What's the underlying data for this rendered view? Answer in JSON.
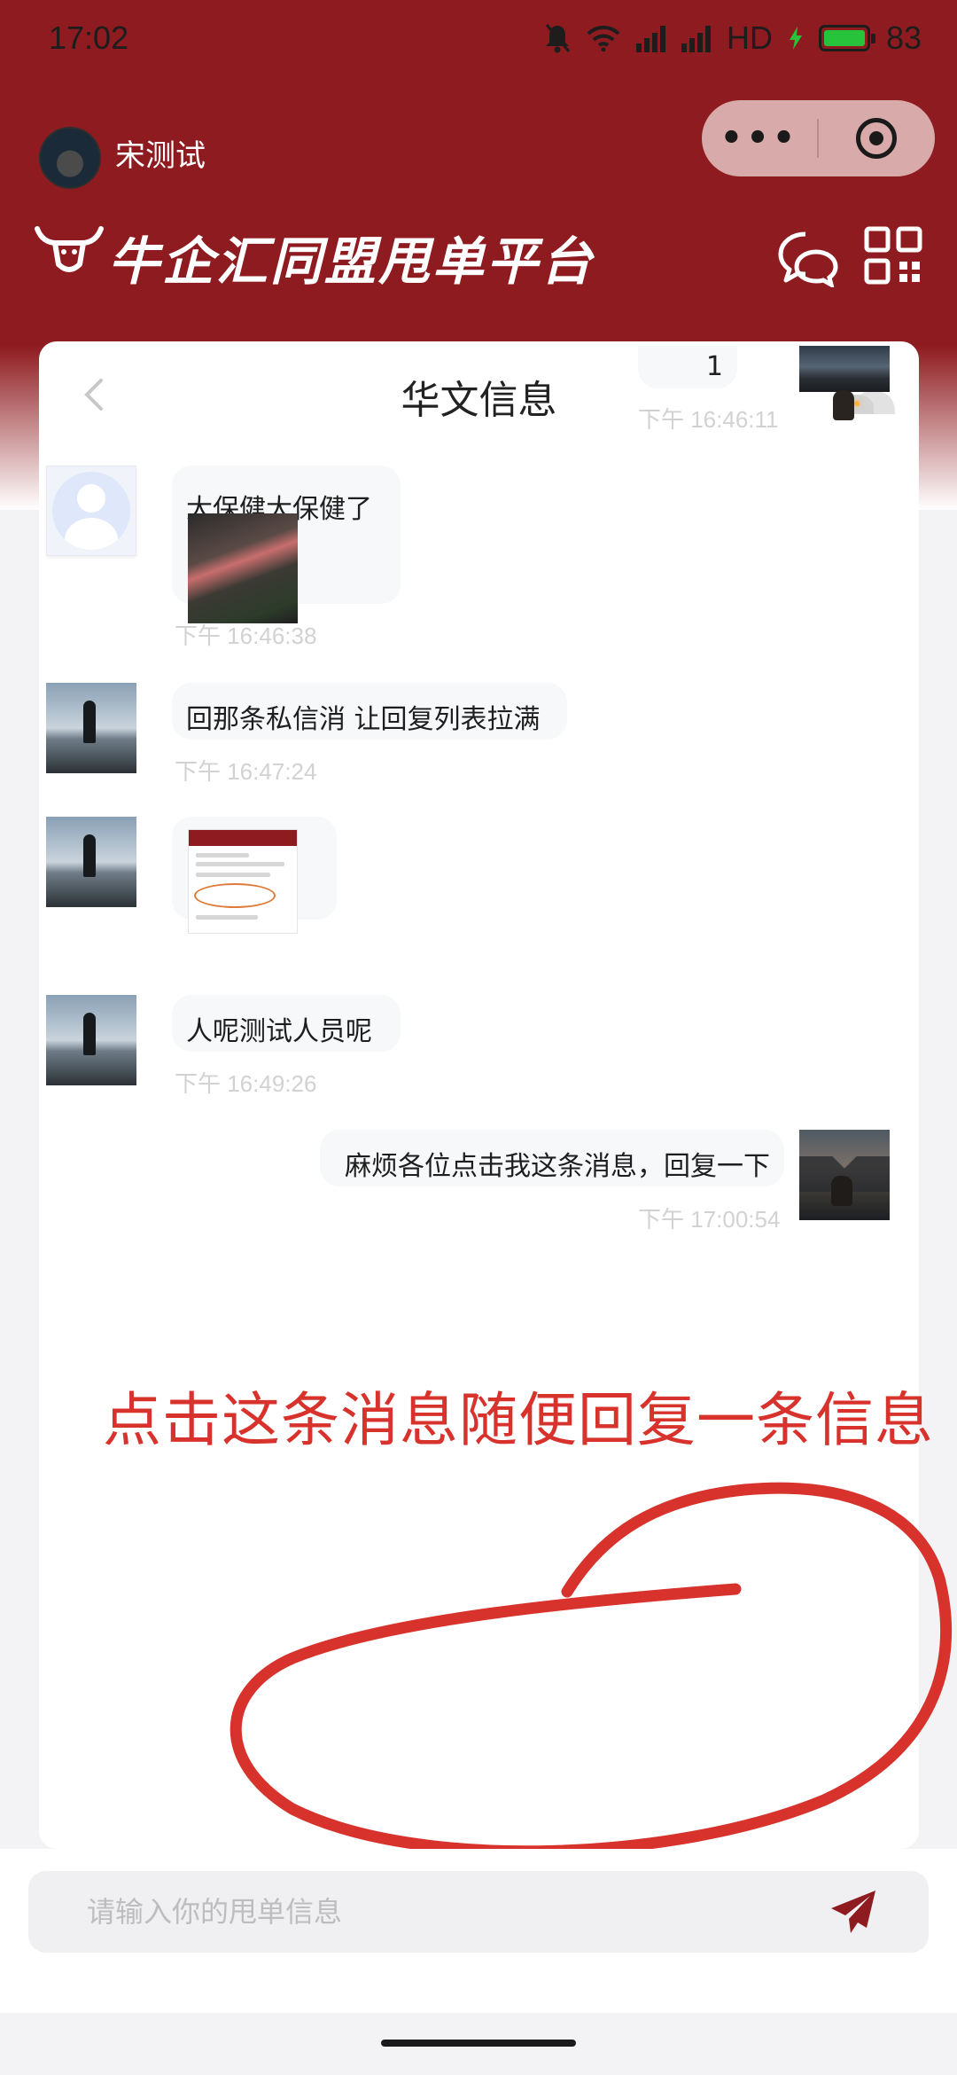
{
  "status_bar": {
    "time": "17:02",
    "network": "HD",
    "battery": "83"
  },
  "top_bar": {
    "user_name": "宋测试",
    "capsule_more": "•••"
  },
  "brand": {
    "title": "牛企汇同盟甩单平台"
  },
  "chat": {
    "title": "华文信息",
    "messages": [
      {
        "side": "right",
        "text": "1",
        "time": "下午 16:46:11"
      },
      {
        "side": "left",
        "text": "大保健大保健了",
        "has_image": true,
        "time": "下午 16:46:38"
      },
      {
        "side": "left",
        "text": "回那条私信消 让回复列表拉满",
        "time": "下午 16:47:24"
      },
      {
        "side": "left",
        "has_image": true
      },
      {
        "side": "left",
        "text": "人呢测试人员呢",
        "time": "下午 16:49:26"
      },
      {
        "side": "right",
        "text": "麻烦各位点击我这条消息，回复一下",
        "time": "下午 17:00:54"
      }
    ]
  },
  "annotation": {
    "text": "点击这条消息随便回复一条信息",
    "color": "#d8322c"
  },
  "input": {
    "placeholder": "请输入你的甩单信息",
    "value": ""
  },
  "colors": {
    "brand": "#8e1b1f",
    "bubble": "#f7f8fa",
    "timestamp": "#d2d2d2"
  }
}
